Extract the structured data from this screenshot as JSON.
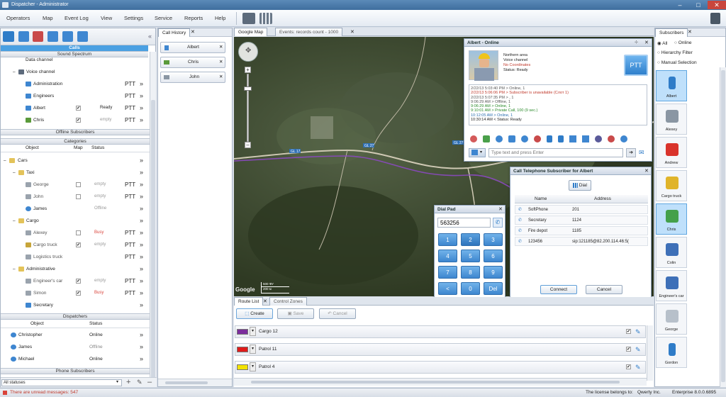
{
  "window": {
    "title": "Dispatcher - Administrator",
    "minimize": "–",
    "maximize": "□",
    "close": "✕"
  },
  "menu": [
    "Operators",
    "Map",
    "Event Log",
    "View",
    "Settings",
    "Service",
    "Reports",
    "Help"
  ],
  "left_panel": {
    "tabs_header": "Calls",
    "sound_spectrum": "Sound Spectrum",
    "data_channel": "Data channel",
    "voice_channel": "Voice channel",
    "voice_items": [
      {
        "name": "Administration",
        "status": "",
        "ptt": "PTT"
      },
      {
        "name": "Engineers",
        "status": "",
        "ptt": "PTT"
      },
      {
        "name": "Albert",
        "status": "Ready",
        "ptt": "PTT",
        "check": "✔"
      },
      {
        "name": "Chris",
        "status": "empty",
        "ptt": "PTT",
        "check": "✔"
      }
    ],
    "offline_subscribers": "Offline Subscribers",
    "categories": "Categories",
    "columns": {
      "object": "Object",
      "map": "Map",
      "status": "Status"
    },
    "cars": "Cars",
    "taxi": "Taxi",
    "taxi_items": [
      {
        "name": "George",
        "status": "empty",
        "ptt": "PTT"
      },
      {
        "name": "John",
        "status": "empty",
        "ptt": "PTT"
      },
      {
        "name": "James",
        "status": "Offline",
        "ptt": ""
      }
    ],
    "cargo": "Cargo",
    "cargo_items": [
      {
        "name": "Alexey",
        "status": "Busy",
        "ptt": "PTT"
      },
      {
        "name": "Cargo truck",
        "status": "empty",
        "ptt": "PTT",
        "check": "✔"
      },
      {
        "name": "Logistics truck",
        "status": "",
        "ptt": "PTT"
      }
    ],
    "administrative": "Administrative",
    "admin_items": [
      {
        "name": "Engineer's car",
        "status": "empty",
        "ptt": "PTT",
        "check": "✔"
      },
      {
        "name": "Simon",
        "status": "Busy",
        "ptt": "PTT",
        "check": "✔"
      },
      {
        "name": "Secretary",
        "status": "",
        "ptt": ""
      }
    ],
    "dispatchers": "Dispatchers",
    "disp_columns": {
      "object": "Object",
      "status": "Status"
    },
    "disp_items": [
      {
        "name": "Christopher",
        "status": "Online"
      },
      {
        "name": "James",
        "status": "Offline"
      },
      {
        "name": "Michael",
        "status": "Online"
      }
    ],
    "phone_subscribers": "Phone Subscribers",
    "filter": "All statuses"
  },
  "call_history": {
    "tab": "Call History",
    "items": [
      "Albert",
      "Chris",
      "John"
    ]
  },
  "map": {
    "tabs": [
      "Google Map",
      "Events: records count - 1000"
    ],
    "road_labels": [
      "GL 27",
      "GL 27",
      "GL 17"
    ],
    "scale": [
      "500 ФУ",
      "200 м"
    ],
    "logo": "Google"
  },
  "albert_window": {
    "title": "Albert - Online",
    "info": [
      "Northern area",
      "Voice channel",
      "No Coordinates",
      "Status:  Ready"
    ],
    "ptt": "PTT",
    "log": [
      {
        "t": "2/22/13 5:03:40 PM > Online, 1",
        "c": "#555"
      },
      {
        "t": "2/22/13 5:06:06 PM > Subscriber is unavailable (Слот 1)",
        "c": "#c0392b"
      },
      {
        "t": "2/22/13 5:07:35 PM > , 1",
        "c": "#555"
      },
      {
        "t": "9:06:29 AM > Offline, 1",
        "c": "#555"
      },
      {
        "t": "9:06:29 AM > Online, 1",
        "c": "#2a8a2a"
      },
      {
        "t": "9:10:01 AM > Private Call, 100 (9 sec.)",
        "c": "#2a8a2a"
      },
      {
        "t": "10:12:05 AM > Online, 1",
        "c": "#2a6fb0"
      },
      {
        "t": "10:30:14 AM < Status: Ready",
        "c": "#222"
      }
    ],
    "input_placeholder": "Type text and press Enter"
  },
  "call_telephone": {
    "title": "Call Telephone Subscriber for Albert",
    "dial": "Dial",
    "columns": [
      "Name",
      "Address"
    ],
    "rows": [
      {
        "name": "SoftPhone",
        "address": "201"
      },
      {
        "name": "Secretary",
        "address": "1124"
      },
      {
        "name": "Fire depot",
        "address": "1185"
      },
      {
        "name": "123456",
        "address": "sip:121185@82.200.114.46:5("
      }
    ],
    "connect": "Connect",
    "cancel": "Cancel"
  },
  "dial_pad": {
    "title": "Dial Pad",
    "value": "563256",
    "keys": [
      "1",
      "2",
      "3",
      "4",
      "5",
      "6",
      "7",
      "8",
      "9",
      "<",
      "0",
      "Del"
    ]
  },
  "route_list": {
    "tabs": [
      "Route List",
      "Control Zones"
    ],
    "create": "Create",
    "save": "Save",
    "cancel": "Cancel",
    "routes": [
      {
        "name": "Cargo 12",
        "color": "#7b2d9c"
      },
      {
        "name": "Patrol 11",
        "color": "#e01a1a"
      },
      {
        "name": "Patrol 4",
        "color": "#f2e200"
      }
    ]
  },
  "subscribers": {
    "tab": "Subscribers",
    "filters": [
      "All",
      "Online"
    ],
    "hierarchy": "Hierarchy Filter",
    "manual": "Manual Selection",
    "items": [
      {
        "name": "Albert",
        "kind": "radio",
        "selected": true
      },
      {
        "name": "Alexey",
        "kind": "truck",
        "selected": false
      },
      {
        "name": "Andrew",
        "kind": "car-red",
        "selected": false
      },
      {
        "name": "Cargo truck",
        "kind": "truck-yellow",
        "selected": false
      },
      {
        "name": "Chris",
        "kind": "car-green",
        "selected": true
      },
      {
        "name": "Colin",
        "kind": "car-blue",
        "selected": false
      },
      {
        "name": "Engineer's car",
        "kind": "car-blue",
        "selected": false
      },
      {
        "name": "George",
        "kind": "van",
        "selected": false
      },
      {
        "name": "Gordon",
        "kind": "radio",
        "selected": false
      }
    ]
  },
  "status": {
    "unread": "There are unread messages: 547",
    "license": "The license belongs to:",
    "licensee": "Qwerty Inc.",
    "edition": "Enterprise 8.0.0.6895"
  }
}
